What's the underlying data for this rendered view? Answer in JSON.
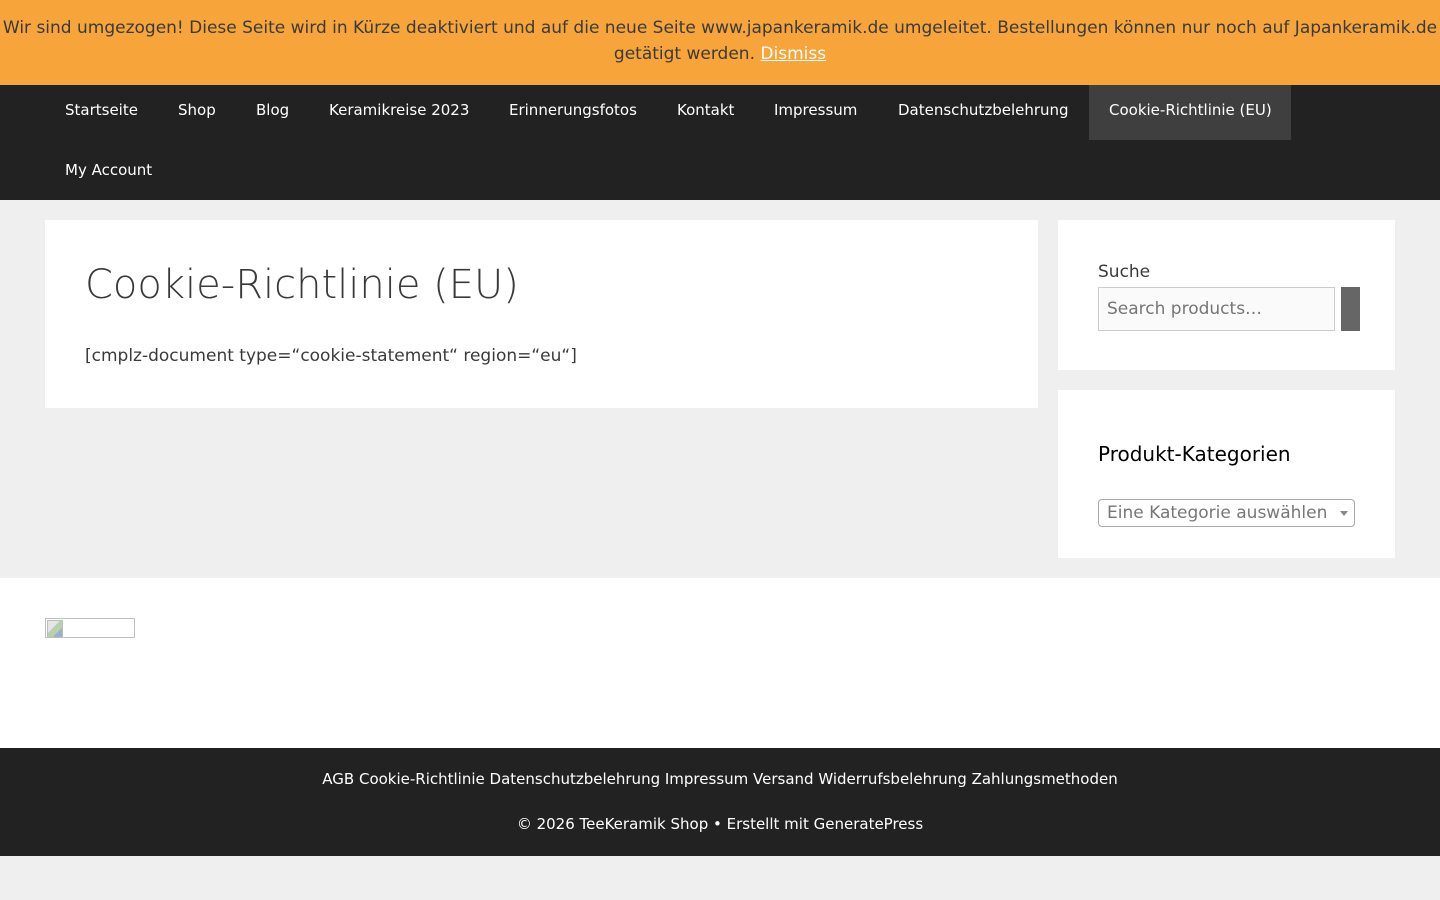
{
  "notice": {
    "message": "Wir sind umgezogen! Diese Seite wird in Kürze deaktiviert und auf die neue Seite www.japankeramik.de umgeleitet. Bestellungen können nur noch auf Japankeramik.de getätigt werden.",
    "dismiss_label": "Dismiss",
    "background": "#f7a53b"
  },
  "nav": {
    "items": [
      {
        "label": "Startseite"
      },
      {
        "label": "Shop"
      },
      {
        "label": "Blog"
      },
      {
        "label": "Keramikreise 2023"
      },
      {
        "label": "Erinnerungsfotos"
      },
      {
        "label": "Kontakt"
      },
      {
        "label": "Impressum"
      },
      {
        "label": "Datenschutzbelehrung"
      },
      {
        "label": "Cookie-Richtlinie (EU)",
        "active": true
      },
      {
        "label": "My Account"
      }
    ],
    "background": "#222222"
  },
  "main": {
    "title": "Cookie-Richtlinie (EU)",
    "body": "[cmplz-document type=“cookie-statement“ region=“eu“]"
  },
  "sidebar": {
    "search": {
      "label": "Suche",
      "placeholder": "Search products…"
    },
    "categories": {
      "title": "Produkt-Kategorien",
      "selected": "Eine Kategorie auswählen"
    }
  },
  "footer": {
    "links": [
      "AGB",
      "Cookie-Richtlinie",
      "Datenschutzbelehrung",
      "Impressum",
      "Versand",
      "Widerrufsbelehrung",
      "Zahlungsmethoden"
    ],
    "copyright": "© 2026 TeeKeramik Shop • Erstellt mit",
    "generator": "GeneratePress"
  }
}
